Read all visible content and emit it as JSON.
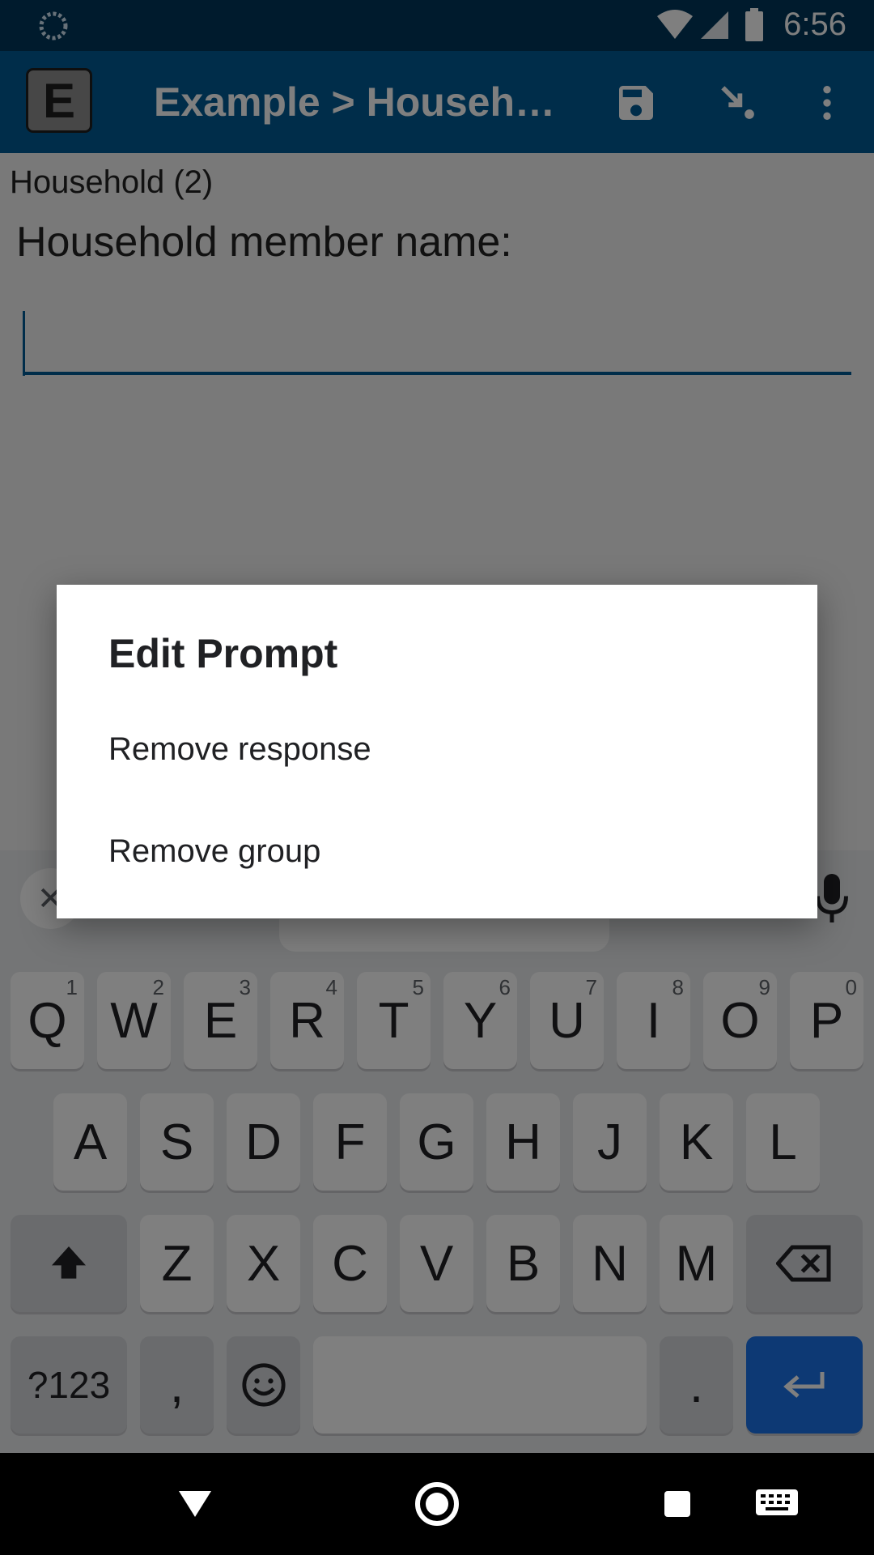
{
  "status_bar": {
    "time": "6:56"
  },
  "app_bar": {
    "logo_letter": "E",
    "title": "Example > Household"
  },
  "content": {
    "group_label": "Household (2)",
    "question": "Household member name:",
    "answer_value": ""
  },
  "keyboard": {
    "row1": [
      {
        "key": "Q",
        "hint": "1"
      },
      {
        "key": "W",
        "hint": "2"
      },
      {
        "key": "E",
        "hint": "3"
      },
      {
        "key": "R",
        "hint": "4"
      },
      {
        "key": "T",
        "hint": "5"
      },
      {
        "key": "Y",
        "hint": "6"
      },
      {
        "key": "U",
        "hint": "7"
      },
      {
        "key": "I",
        "hint": "8"
      },
      {
        "key": "O",
        "hint": "9"
      },
      {
        "key": "P",
        "hint": "0"
      }
    ],
    "row2": [
      "A",
      "S",
      "D",
      "F",
      "G",
      "H",
      "J",
      "K",
      "L"
    ],
    "row3": [
      "Z",
      "X",
      "C",
      "V",
      "B",
      "N",
      "M"
    ],
    "symbols_label": "?123",
    "comma": ",",
    "period": "."
  },
  "dialog": {
    "title": "Edit Prompt",
    "items": [
      "Remove response",
      "Remove group"
    ]
  },
  "colors": {
    "app_bar": "#005a94",
    "status_bar": "#00375a",
    "accent": "#1a73e8"
  }
}
